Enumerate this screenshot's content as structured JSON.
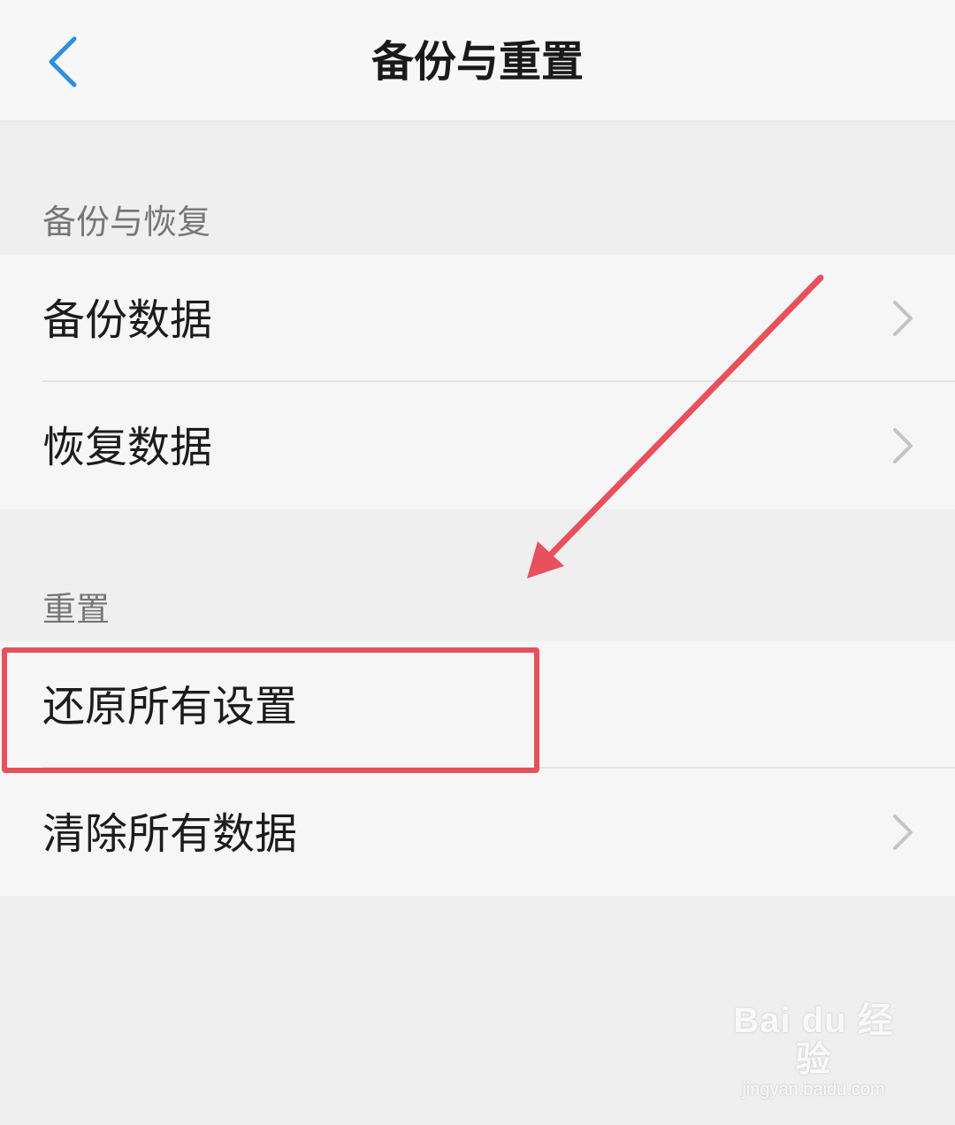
{
  "header": {
    "title": "备份与重置",
    "back_icon": "chevron-left-icon",
    "accent_color": "#2f8fe0"
  },
  "sections": [
    {
      "title": "备份与恢复",
      "items": [
        {
          "label": "备份数据",
          "icon": "chevron-right-icon"
        },
        {
          "label": "恢复数据",
          "icon": "chevron-right-icon"
        }
      ]
    },
    {
      "title": "重置",
      "items": [
        {
          "label": "还原所有设置",
          "icon": ""
        },
        {
          "label": "清除所有数据",
          "icon": "chevron-right-icon"
        }
      ]
    }
  ],
  "annotation": {
    "color": "#e8505b",
    "highlighted_item": "还原所有设置"
  },
  "watermark": {
    "logo": "Bai du 经验",
    "url": "jingyan.baidu.com"
  }
}
